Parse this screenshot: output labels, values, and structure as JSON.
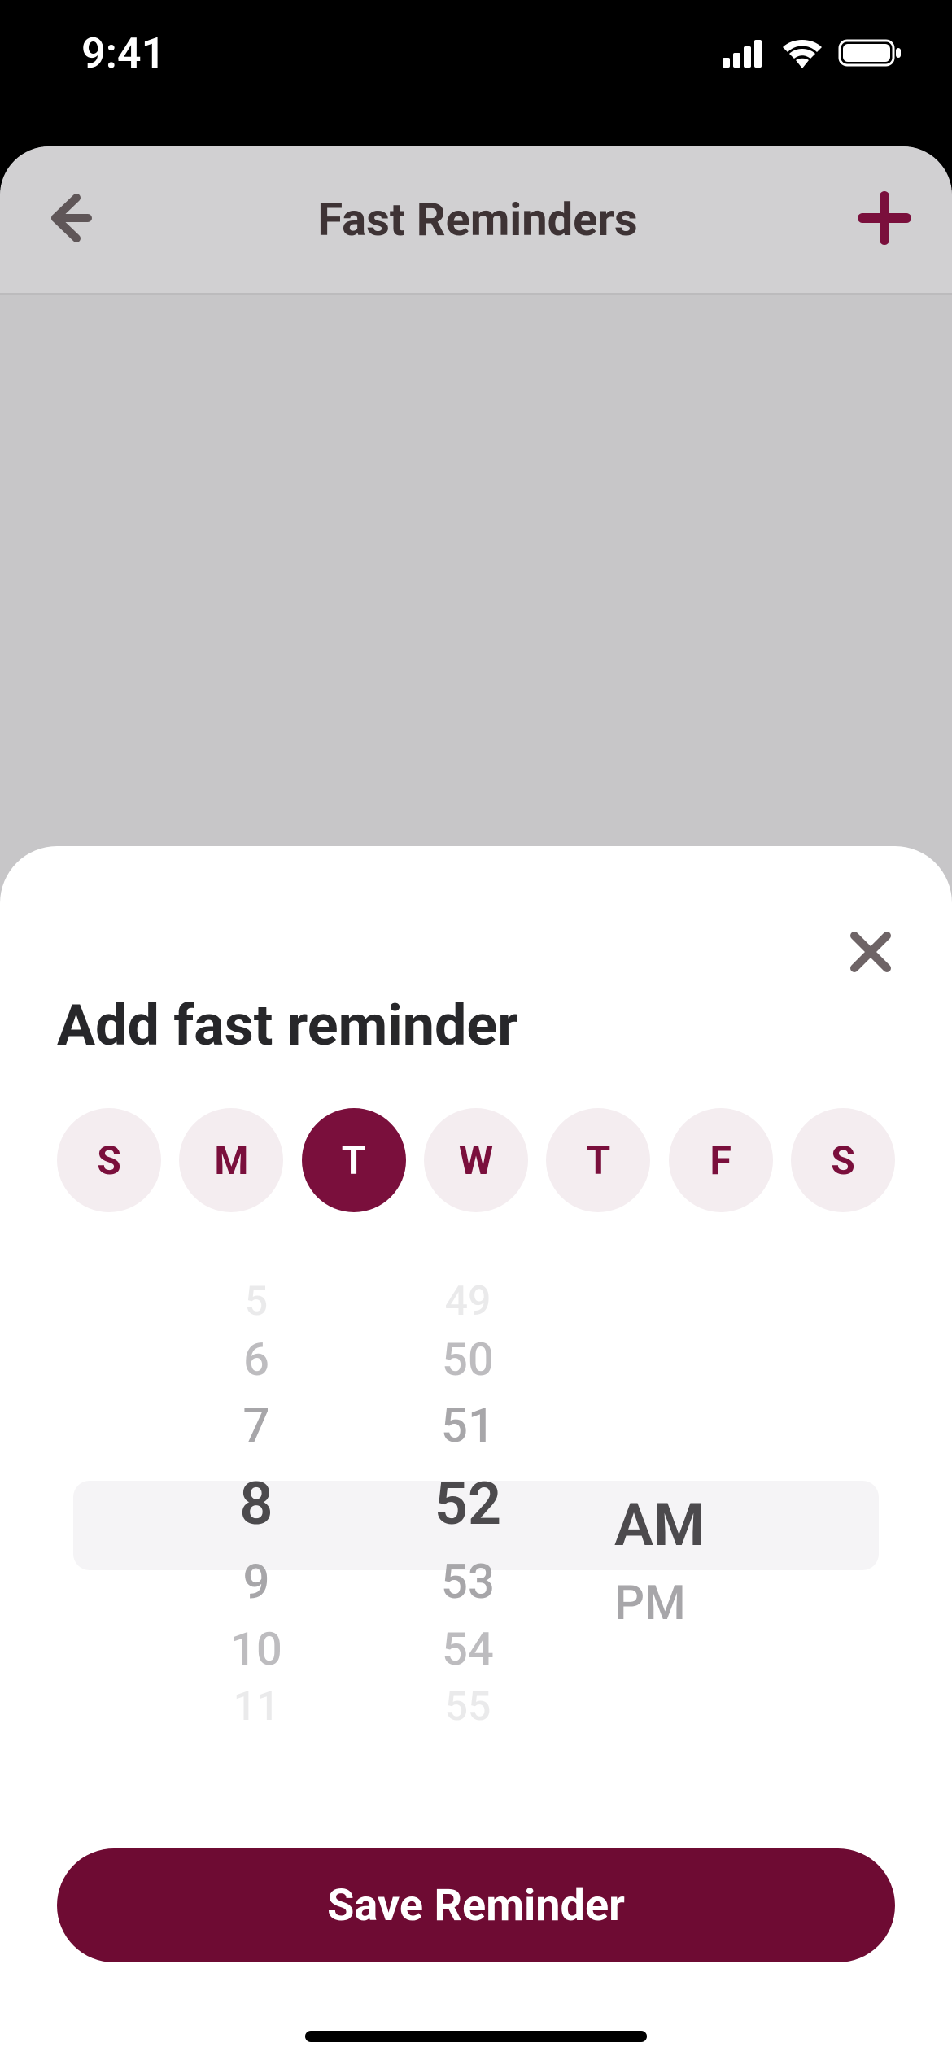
{
  "status": {
    "time": "9:41"
  },
  "background_page": {
    "title": "Fast Reminders"
  },
  "modal": {
    "title": "Add fast reminder",
    "days": [
      {
        "label": "S",
        "selected": false
      },
      {
        "label": "M",
        "selected": false
      },
      {
        "label": "T",
        "selected": true
      },
      {
        "label": "W",
        "selected": false
      },
      {
        "label": "T",
        "selected": false
      },
      {
        "label": "F",
        "selected": false
      },
      {
        "label": "S",
        "selected": false
      }
    ],
    "time_picker": {
      "hours": {
        "visible": [
          "5",
          "6",
          "7",
          "8",
          "9",
          "10",
          "11"
        ],
        "selected_index": 3
      },
      "minutes": {
        "visible": [
          "49",
          "50",
          "51",
          "52",
          "53",
          "54",
          "55"
        ],
        "selected_index": 3
      },
      "period": {
        "options": [
          "AM",
          "PM"
        ],
        "selected_index": 0
      }
    },
    "save_label": "Save Reminder"
  }
}
